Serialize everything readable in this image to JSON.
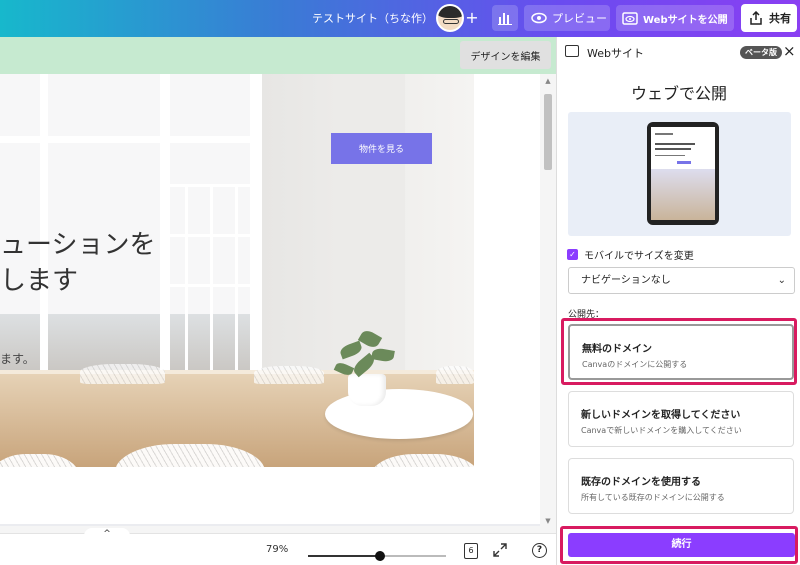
{
  "topbar": {
    "site_title": "テストサイト（ちな作）",
    "plus": "+",
    "preview_label": "プレビュー",
    "publish_label": "Webサイトを公開",
    "share_label": "共有"
  },
  "canvas": {
    "edit_design_label": "デザインを編集",
    "view_properties_label": "物件を見る",
    "headline_line1": "ューションを",
    "headline_line2": "します",
    "subtext": "ます。"
  },
  "bottombar": {
    "collapse": "^",
    "zoom_label": "79%",
    "zoom_level": 0.52,
    "page_count": "6",
    "help": "?"
  },
  "panel": {
    "header_title": "Webサイト",
    "beta_badge": "ベータ版",
    "close": "×",
    "heading": "ウェブで公開",
    "mobile_resize_label": "モバイルでサイズを変更",
    "mobile_resize_checked": true,
    "nav_select_value": "ナビゲーションなし",
    "destination_label": "公開先：",
    "options": [
      {
        "title": "無料のドメイン",
        "desc": "Canvaのドメインに公開する"
      },
      {
        "title": "新しいドメインを取得してください",
        "desc": "Canvaで新しいドメインを購入してください"
      },
      {
        "title": "既存のドメインを使用する",
        "desc": "所有している既存のドメインに公開する"
      }
    ],
    "continue_label": "続行"
  },
  "colors": {
    "accent": "#8b3dff",
    "highlight": "#d81b60",
    "green_bar": "#c6ead0",
    "button_purple": "#7773e8"
  }
}
